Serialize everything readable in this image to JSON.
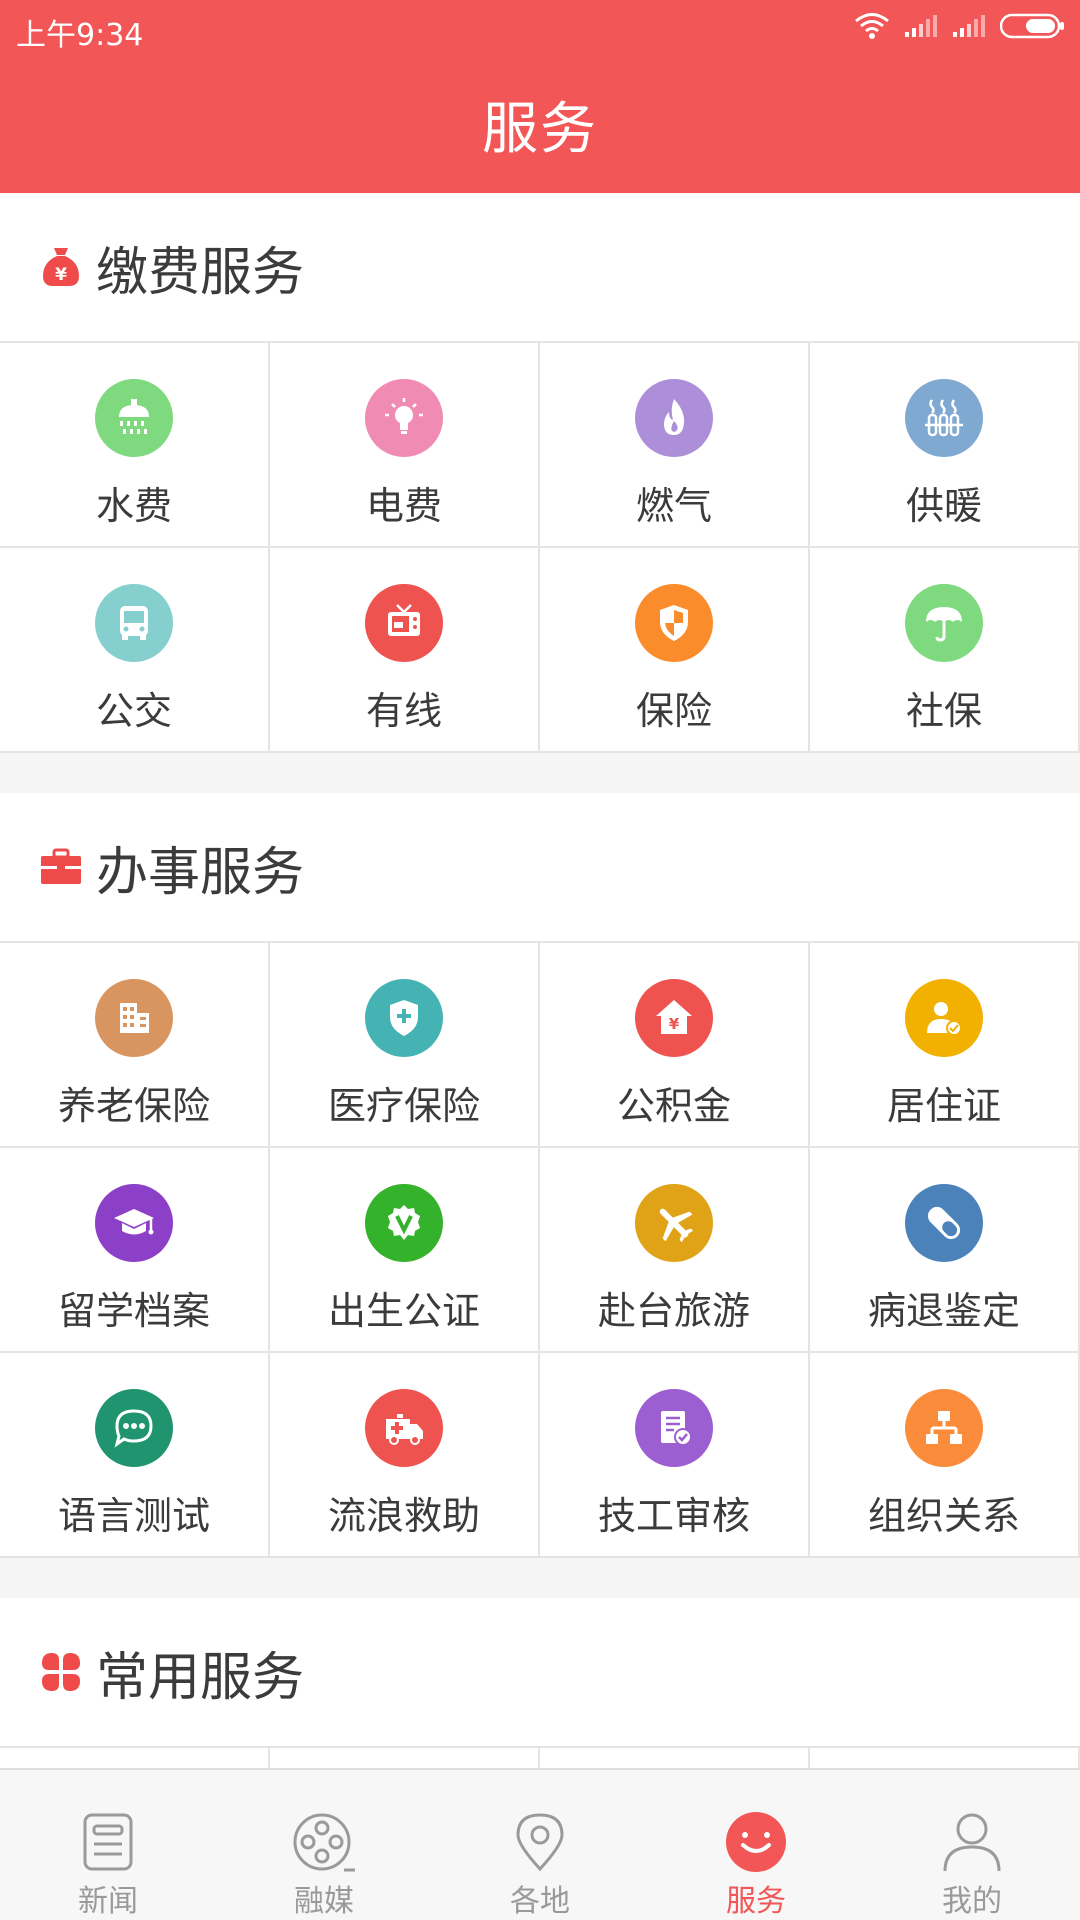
{
  "status_bar": {
    "time": "上午9:34"
  },
  "header": {
    "title": "服务"
  },
  "sections": [
    {
      "title": "缴费服务",
      "items": [
        {
          "label": "水费",
          "color": "#7fd97f",
          "icon": "shower-icon"
        },
        {
          "label": "电费",
          "color": "#f08cb4",
          "icon": "light-bulb-icon"
        },
        {
          "label": "燃气",
          "color": "#ad8fd9",
          "icon": "flame-icon"
        },
        {
          "label": "供暖",
          "color": "#7fa9d1",
          "icon": "heater-icon"
        },
        {
          "label": "公交",
          "color": "#86cfcf",
          "icon": "bus-icon"
        },
        {
          "label": "有线",
          "color": "#ef5350",
          "icon": "tv-icon"
        },
        {
          "label": "保险",
          "color": "#fb8c2c",
          "icon": "shield-icon"
        },
        {
          "label": "社保",
          "color": "#7fd97f",
          "icon": "umbrella-icon"
        }
      ]
    },
    {
      "title": "办事服务",
      "items": [
        {
          "label": "养老保险",
          "color": "#d99560",
          "icon": "building-icon"
        },
        {
          "label": "医疗保险",
          "color": "#45b3b3",
          "icon": "medical-shield-icon"
        },
        {
          "label": "公积金",
          "color": "#ef5350",
          "icon": "house-yen-icon"
        },
        {
          "label": "居住证",
          "color": "#f2b000",
          "icon": "person-check-icon"
        },
        {
          "label": "留学档案",
          "color": "#8c3fc7",
          "icon": "graduation-cap-icon"
        },
        {
          "label": "出生公证",
          "color": "#35b22b",
          "icon": "v-badge-icon"
        },
        {
          "label": "赴台旅游",
          "color": "#e0a317",
          "icon": "airplane-icon"
        },
        {
          "label": "病退鉴定",
          "color": "#4a82b9",
          "icon": "pill-icon"
        },
        {
          "label": "语言测试",
          "color": "#1f946e",
          "icon": "chat-bubble-icon"
        },
        {
          "label": "流浪救助",
          "color": "#ef5350",
          "icon": "ambulance-icon"
        },
        {
          "label": "技工审核",
          "color": "#9b5fd1",
          "icon": "document-check-icon"
        },
        {
          "label": "组织关系",
          "color": "#fb8c3c",
          "icon": "org-chart-icon"
        }
      ]
    },
    {
      "title": "常用服务",
      "items": []
    }
  ],
  "tabbar": [
    {
      "label": "新闻",
      "icon": "news-icon",
      "active": false
    },
    {
      "label": "融媒",
      "icon": "film-reel-icon",
      "active": false
    },
    {
      "label": "各地",
      "icon": "location-pin-icon",
      "active": false
    },
    {
      "label": "服务",
      "icon": "smile-icon",
      "active": true
    },
    {
      "label": "我的",
      "icon": "person-icon",
      "active": false
    }
  ],
  "colors": {
    "accent": "#f25656",
    "tab_inactive": "#9a9a9a",
    "divider": "#e4e4e4"
  }
}
